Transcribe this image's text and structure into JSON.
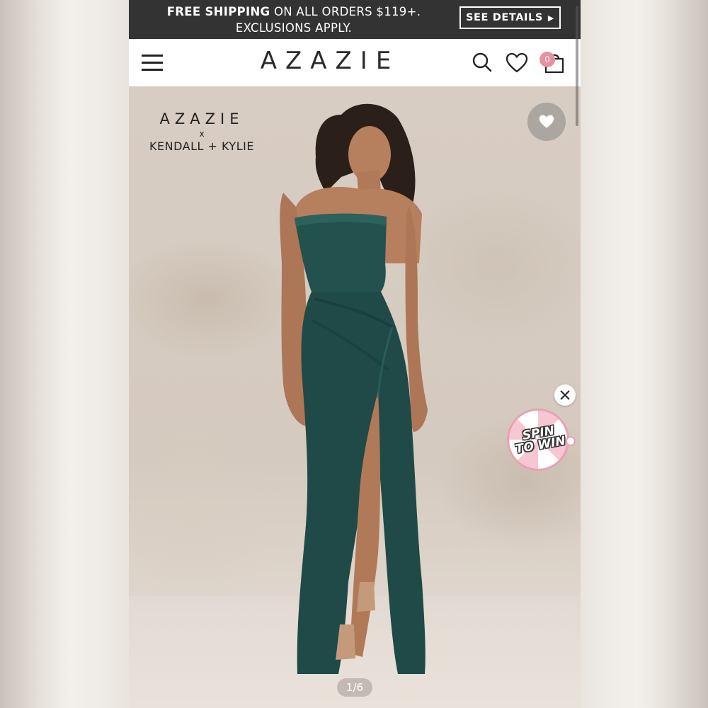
{
  "promo": {
    "line1_bold": "FREE SHIPPING",
    "line1_rest": " ON ALL ORDERS $119+.",
    "line2": "EXCLUSIONS APPLY.",
    "button_label": "SEE DETAILS",
    "button_arrow": "▶"
  },
  "header": {
    "logo": "AZAZIE",
    "icons": [
      "menu-icon",
      "search-icon",
      "heart-icon",
      "cart-icon"
    ],
    "cart_count": "0"
  },
  "hero": {
    "brand_line1": "AZAZIE",
    "brand_x": "x",
    "brand_line2": "KENDALL + KYLIE",
    "spin_line1": "SPIN",
    "spin_line2": "TO WIN",
    "pager": "1/6",
    "dress_color": "#1f4a47"
  },
  "colors": {
    "banner_bg": "#333333",
    "badge": "#e88fa0"
  }
}
